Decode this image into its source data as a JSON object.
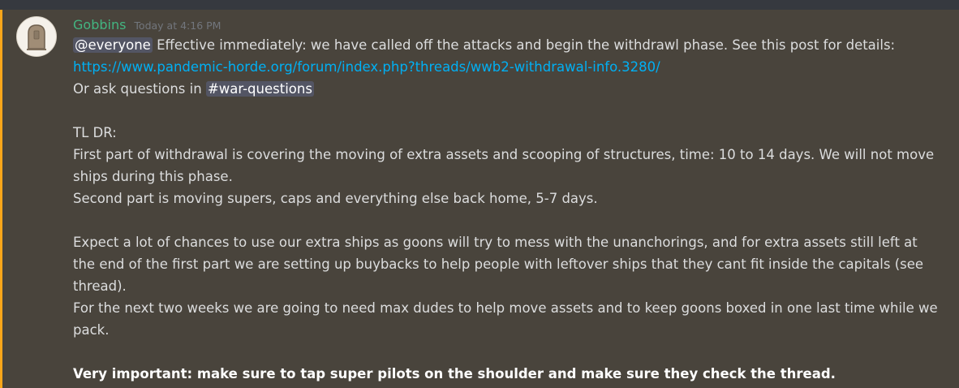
{
  "message": {
    "username": "Gobbins",
    "timestamp": "Today at 4:16 PM",
    "avatar_icon": "tombstone-avatar-icon",
    "accent_color": "#faa61a",
    "mention": "@everyone",
    "line1_text": " Effective immediately: we have called off the attacks and begin the withdrawl phase. See this post for details:",
    "link": "https://www.pandemic-horde.org/forum/index.php?threads/wwb2-withdrawal-info.3280/",
    "ask_prefix": "Or ask questions in ",
    "channel": "#war-questions",
    "tldr": "TL DR:",
    "para1_line1": "First part of withdrawal is covering the moving of extra assets and scooping of structures, time: 10 to 14 days. We will not move",
    "para1_line2": "ships during this phase.",
    "para1_line3": "Second part is moving supers, caps and everything else back home, 5-7 days.",
    "para2_line1": "Expect a lot of chances to use our extra ships as goons will try to mess with the unanchorings, and for extra assets still left at",
    "para2_line2": "the end of the first part we are setting up buybacks to help people with leftover ships that they cant fit inside the capitals (see",
    "para2_line3": "thread).",
    "para2_line4": "For the next two weeks we are going to need max dudes to help move assets and to keep goons boxed in one last time while we",
    "para2_line5": "pack.",
    "important": "Very important: make sure to tap super pilots on the shoulder and make sure they check the thread."
  }
}
